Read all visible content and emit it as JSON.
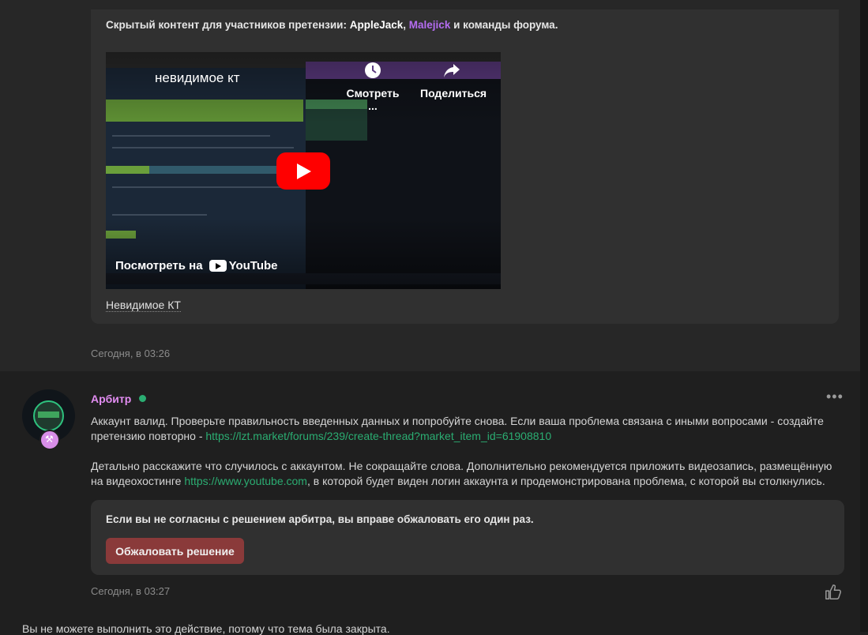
{
  "post1": {
    "hidden_prefix": "Скрытый контент для участников претензии: ",
    "member1": "AppleJack",
    "separator": ", ",
    "member2": "Malejick",
    "hidden_suffix": " и команды форума.",
    "video": {
      "title": "невидимое кт",
      "watch_later": "Смотреть ...",
      "share": "Поделиться",
      "watch_on": "Посмотреть на",
      "youtube": "YouTube"
    },
    "caption": "Невидимое КТ",
    "time": "Сегодня, в 03:26"
  },
  "post2": {
    "username": "Арбитр",
    "more": "•••",
    "msg1": "Аккаунт валид. Проверьте правильность введенных данных и попробуйте снова. Если ваша проблема связана с иными вопросами - создайте претензию повторно - ",
    "link1": "https://lzt.market/forums/239/create-thread?market_item_id=61908810",
    "msg2_pre": "Детально расскажите что случилось с аккаунтом. Не сокращайте слова. Дополнительно рекомендуется приложить видеозапись, размещённую на видеохостинге ",
    "link2": "https://www.youtube.com",
    "msg2_post": ", в которой будет виден логин аккаунта и продемонстрирована проблема, с которой вы столкнулись.",
    "appeal_text": "Если вы не согласны с решением арбитра, вы вправе обжаловать его один раз.",
    "appeal_button": "Обжаловать решение",
    "time": "Сегодня, в 03:27"
  },
  "footer": {
    "note": "Вы не можете выполнить это действие, потому что тема была закрыта."
  },
  "colors": {
    "accent_link": "#2bad72",
    "arbiter_name": "#e18cf0",
    "appeal_button": "#8a3a3a"
  }
}
